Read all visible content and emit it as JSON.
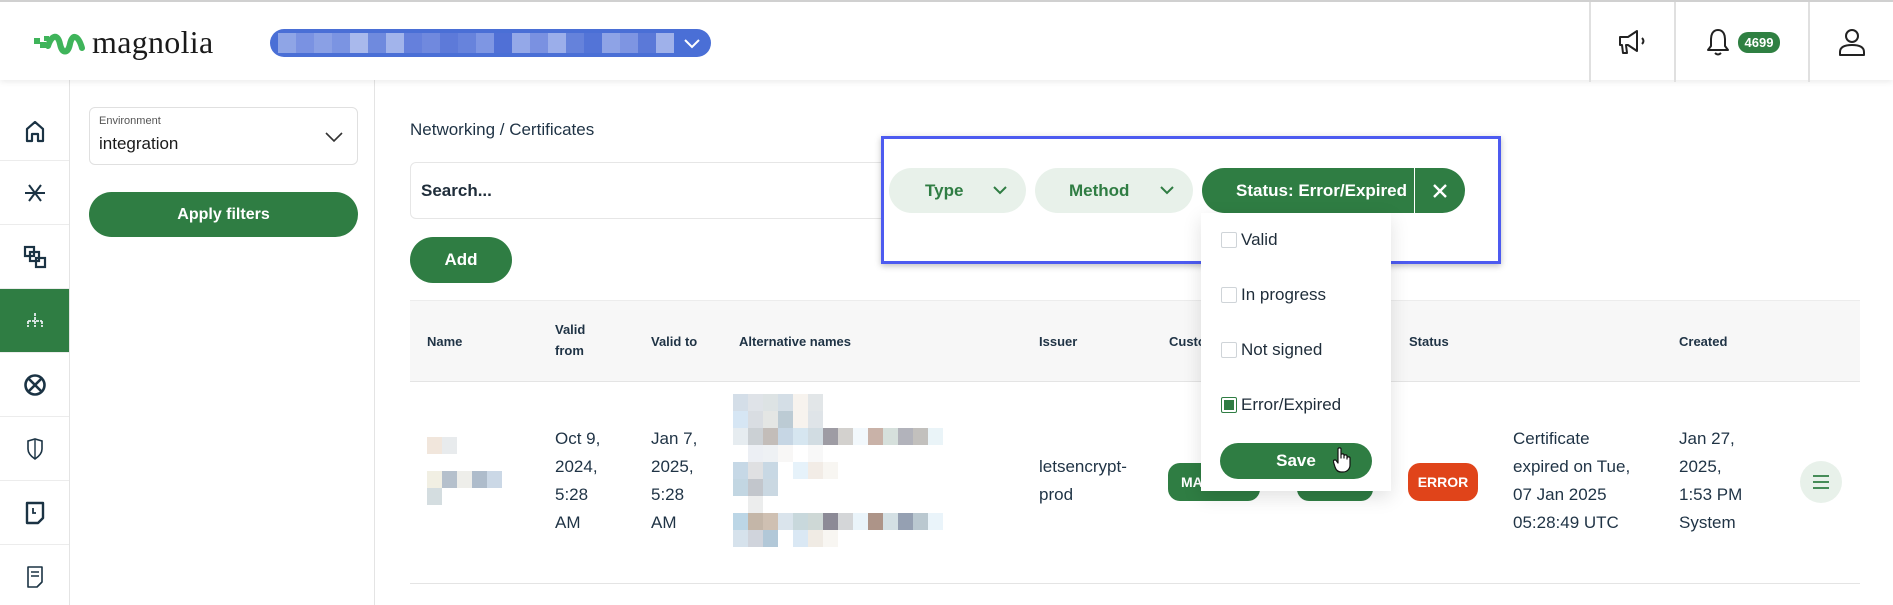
{
  "header": {
    "logo_text": "magnolia",
    "environment_selector_value": "[redacted]",
    "notifications_count": "4699",
    "icons": [
      "announcements-icon",
      "bell-icon",
      "user-icon"
    ]
  },
  "rail": {
    "items": [
      {
        "icon": "home-icon",
        "active": false
      },
      {
        "icon": "asterisk-icon",
        "active": false
      },
      {
        "icon": "stacked-squares-icon",
        "active": false
      },
      {
        "icon": "network-tree-icon",
        "active": true
      },
      {
        "icon": "globe-icon",
        "active": false
      },
      {
        "icon": "shield-icon",
        "active": false
      },
      {
        "icon": "document-clock-icon",
        "active": false
      },
      {
        "icon": "document-icon",
        "active": false
      }
    ]
  },
  "filters": {
    "environment_label": "Environment",
    "environment_value": "integration",
    "apply_label": "Apply filters"
  },
  "main": {
    "breadcrumb": "Networking / Certificates",
    "search_placeholder": "Search...",
    "add_label": "Add",
    "chips": {
      "type": "Type",
      "method": "Method",
      "status": "Status: Error/Expired"
    },
    "status_dropdown": {
      "options": [
        {
          "label": "Valid",
          "checked": false
        },
        {
          "label": "In progress",
          "checked": false
        },
        {
          "label": "Not signed",
          "checked": false
        },
        {
          "label": "Error/Expired",
          "checked": true
        }
      ],
      "save_label": "Save"
    },
    "table": {
      "columns": [
        "Name",
        "Valid from",
        "Valid to",
        "Alternative names",
        "Issuer",
        "Custom",
        "",
        "Status",
        "",
        "Created"
      ],
      "col_valid_from_l1": "Valid",
      "col_valid_from_l2": "from",
      "rows": [
        {
          "name": "[redacted]",
          "valid_from": [
            "Oct 9,",
            "2024,",
            "5:28",
            "AM"
          ],
          "valid_to": [
            "Jan 7,",
            "2025,",
            "5:28",
            "AM"
          ],
          "alternative_names": "[redacted]",
          "issuer": [
            "letsencrypt-",
            "prod"
          ],
          "custom_tag": "MA",
          "status": "ERROR",
          "status_message": [
            "Certificate",
            "expired on Tue,",
            "07 Jan 2025",
            "05:28:49 UTC"
          ],
          "created": [
            "Jan 27,",
            "2025,",
            "1:53 PM",
            "System"
          ]
        }
      ]
    }
  },
  "colors": {
    "brand_green": "#2f7d43",
    "chip_light": "#e8f1ea",
    "error": "#e0441a",
    "highlight": "#4d5bf0",
    "env_pill": "#4a6fd6"
  }
}
